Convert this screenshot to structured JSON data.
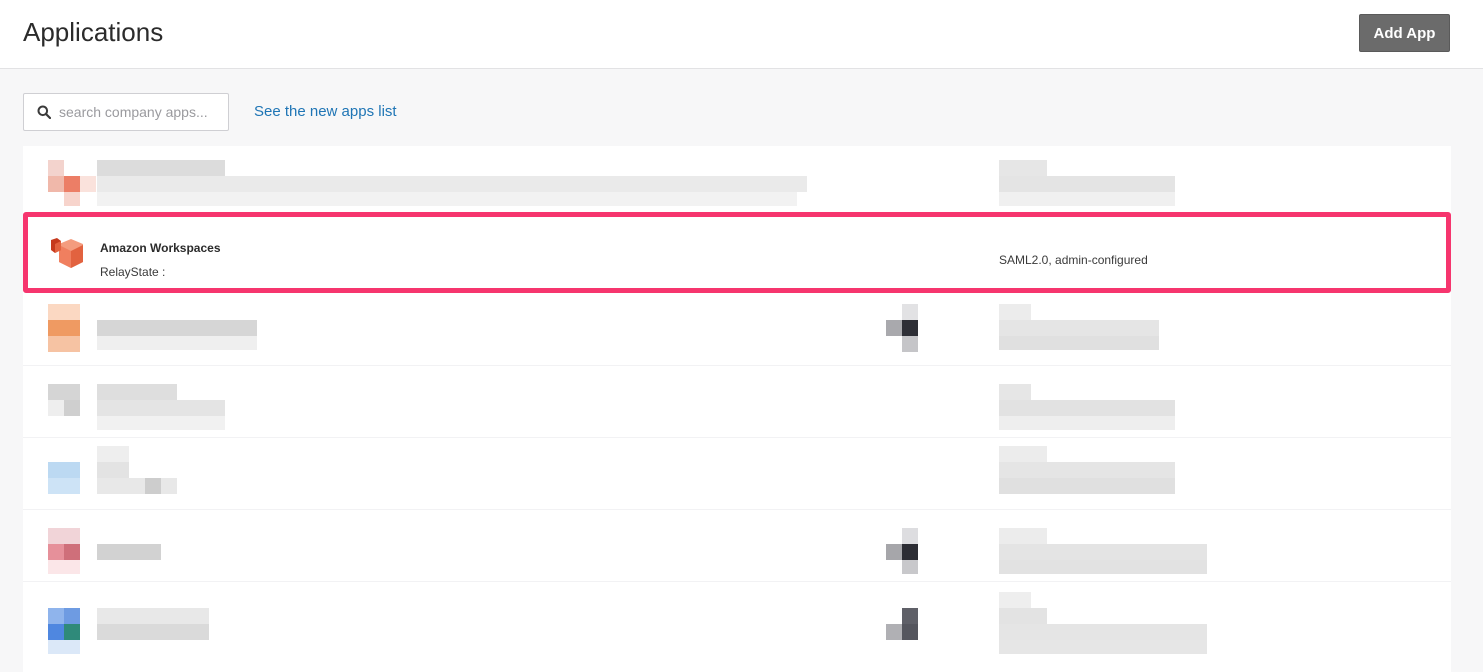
{
  "header": {
    "title": "Applications",
    "add_app_label": "Add App"
  },
  "toolbar": {
    "search_placeholder": "search company apps...",
    "new_apps_link": "See the new apps list"
  },
  "highlighted_app": {
    "name": "Amazon Workspaces",
    "subtitle": "RelayState :",
    "type": "SAML2.0, admin-configured",
    "icon": "amazon-workspaces-icon",
    "highlight_color": "#f6356e"
  },
  "icons": {
    "search": "search-icon"
  },
  "colors": {
    "button_bg": "#6b6b6b",
    "link": "#1f75b5"
  }
}
